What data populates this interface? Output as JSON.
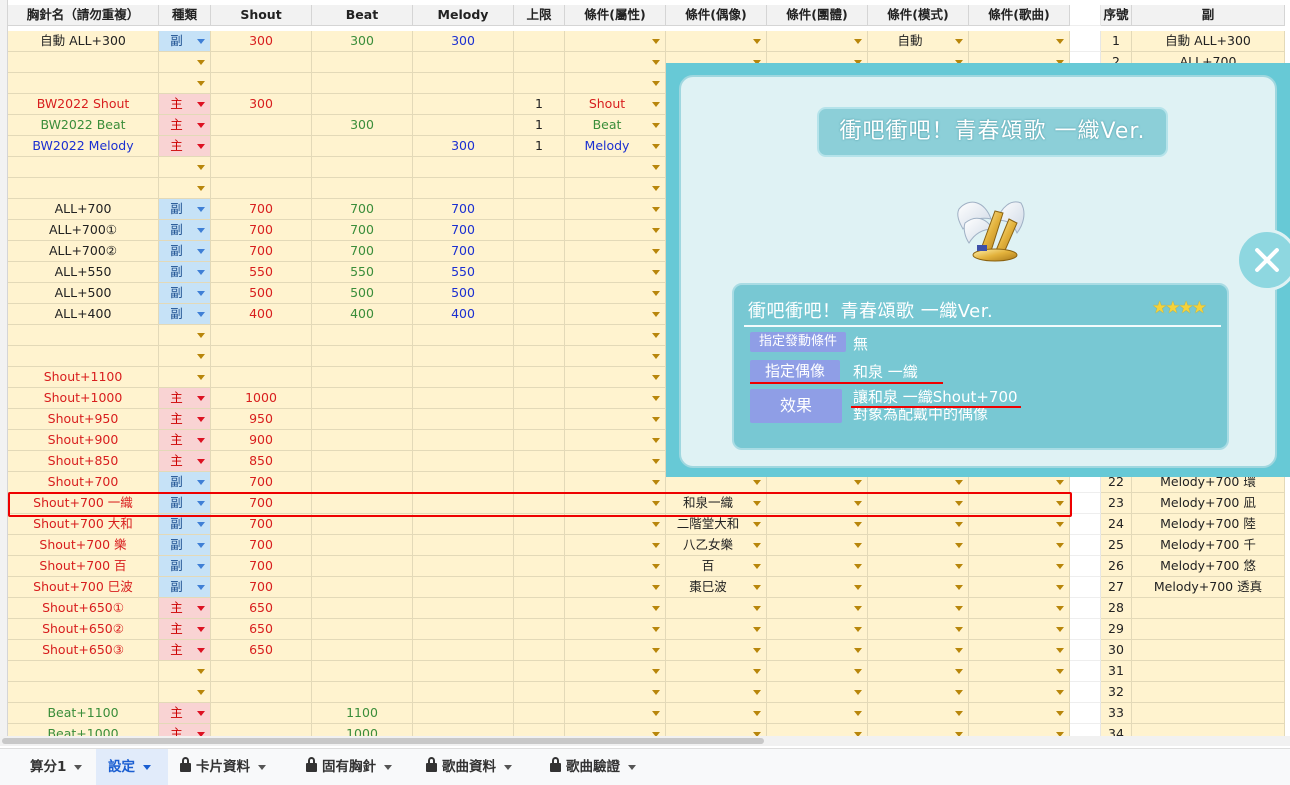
{
  "columns": [
    {
      "key": "name",
      "label": "胸針名（請勿重複）"
    },
    {
      "key": "type",
      "label": "種類"
    },
    {
      "key": "shout",
      "label": "Shout",
      "color": "#d81e1e"
    },
    {
      "key": "beat",
      "label": "Beat",
      "color": "#3a8d3a"
    },
    {
      "key": "melody",
      "label": "Melody",
      "color": "#1b2fd1"
    },
    {
      "key": "limit",
      "label": "上限"
    },
    {
      "key": "attr",
      "label": "條件(屬性)"
    },
    {
      "key": "idol",
      "label": "條件(偶像)"
    },
    {
      "key": "group",
      "label": "條件(團體)"
    },
    {
      "key": "mode",
      "label": "條件(模式)"
    },
    {
      "key": "song",
      "label": "條件(歌曲)"
    },
    {
      "key": "blank",
      "label": ""
    },
    {
      "key": "seq",
      "label": "序號"
    },
    {
      "key": "sub",
      "label": "副"
    }
  ],
  "rows": [
    {
      "name": "自動 ALL+300",
      "nc": "",
      "type": "副",
      "shout": "300",
      "beat": "300",
      "melody": "300",
      "limit": "",
      "attr": "",
      "idol": "",
      "group": "",
      "mode": "自動",
      "song": "",
      "seq": "1",
      "sub": "自動 ALL+300"
    },
    {
      "name": "",
      "nc": "",
      "type": "",
      "shout": "",
      "beat": "",
      "melody": "",
      "limit": "",
      "attr": "",
      "idol": "",
      "group": "",
      "mode": "",
      "song": "",
      "seq": "2",
      "sub": "ALL+700"
    },
    {
      "name": "",
      "nc": "",
      "type": "",
      "shout": "",
      "beat": "",
      "melody": "",
      "limit": "",
      "attr": "",
      "idol": "",
      "group": "",
      "mode": "",
      "song": "",
      "seq": "",
      "sub": ""
    },
    {
      "name": "BW2022 Shout",
      "nc": "red",
      "type": "主",
      "shout": "300",
      "beat": "",
      "melody": "",
      "limit": "1",
      "attr": "Shout",
      "ac": "red",
      "idol": "",
      "group": "",
      "mode": "",
      "song": "",
      "seq": "",
      "sub": ""
    },
    {
      "name": "BW2022 Beat",
      "nc": "green",
      "type": "主",
      "shout": "",
      "beat": "300",
      "melody": "",
      "limit": "1",
      "attr": "Beat",
      "ac": "green",
      "idol": "",
      "group": "",
      "mode": "",
      "song": "",
      "seq": "",
      "sub": ""
    },
    {
      "name": "BW2022 Melody",
      "nc": "blue",
      "type": "主",
      "shout": "",
      "beat": "",
      "melody": "300",
      "limit": "1",
      "attr": "Melody",
      "ac": "blue",
      "idol": "",
      "group": "",
      "mode": "",
      "song": "",
      "seq": "",
      "sub": ""
    },
    {
      "name": "",
      "nc": "",
      "type": "",
      "shout": "",
      "beat": "",
      "melody": "",
      "limit": "",
      "attr": "",
      "idol": "",
      "group": "",
      "mode": "",
      "song": "",
      "seq": "",
      "sub": ""
    },
    {
      "name": "",
      "nc": "",
      "type": "",
      "shout": "",
      "beat": "",
      "melody": "",
      "limit": "",
      "attr": "",
      "idol": "",
      "group": "",
      "mode": "",
      "song": "",
      "seq": "",
      "sub": ""
    },
    {
      "name": "ALL+700",
      "nc": "",
      "type": "副",
      "shout": "700",
      "beat": "700",
      "melody": "700",
      "limit": "",
      "attr": "",
      "idol": "",
      "group": "",
      "mode": "",
      "song": "",
      "seq": "",
      "sub": ""
    },
    {
      "name": "ALL+700①",
      "nc": "",
      "type": "副",
      "shout": "700",
      "beat": "700",
      "melody": "700",
      "limit": "",
      "attr": "",
      "idol": "",
      "group": "",
      "mode": "",
      "song": "",
      "seq": "",
      "sub": ""
    },
    {
      "name": "ALL+700②",
      "nc": "",
      "type": "副",
      "shout": "700",
      "beat": "700",
      "melody": "700",
      "limit": "",
      "attr": "",
      "idol": "",
      "group": "",
      "mode": "",
      "song": "",
      "seq": "",
      "sub": ""
    },
    {
      "name": "ALL+550",
      "nc": "",
      "type": "副",
      "shout": "550",
      "beat": "550",
      "melody": "550",
      "limit": "",
      "attr": "",
      "idol": "",
      "group": "",
      "mode": "",
      "song": "",
      "seq": "",
      "sub": ""
    },
    {
      "name": "ALL+500",
      "nc": "",
      "type": "副",
      "shout": "500",
      "beat": "500",
      "melody": "500",
      "limit": "",
      "attr": "",
      "idol": "",
      "group": "",
      "mode": "",
      "song": "",
      "seq": "",
      "sub": ""
    },
    {
      "name": "ALL+400",
      "nc": "",
      "type": "副",
      "shout": "400",
      "beat": "400",
      "melody": "400",
      "limit": "",
      "attr": "",
      "idol": "",
      "group": "",
      "mode": "",
      "song": "",
      "seq": "",
      "sub": ""
    },
    {
      "name": "",
      "nc": "",
      "type": "",
      "shout": "",
      "beat": "",
      "melody": "",
      "limit": "",
      "attr": "",
      "idol": "",
      "group": "",
      "mode": "",
      "song": "",
      "seq": "",
      "sub": ""
    },
    {
      "name": "",
      "nc": "",
      "type": "",
      "shout": "",
      "beat": "",
      "melody": "",
      "limit": "",
      "attr": "",
      "idol": "",
      "group": "",
      "mode": "",
      "song": "",
      "seq": "",
      "sub": ""
    },
    {
      "name": "Shout+1100",
      "nc": "red",
      "type": "",
      "shout": "",
      "beat": "",
      "melody": "",
      "limit": "",
      "attr": "",
      "idol": "",
      "group": "",
      "mode": "",
      "song": "",
      "seq": "",
      "sub": ""
    },
    {
      "name": "Shout+1000",
      "nc": "red",
      "type": "主",
      "shout": "1000",
      "beat": "",
      "melody": "",
      "limit": "",
      "attr": "",
      "idol": "",
      "group": "",
      "mode": "",
      "song": "",
      "seq": "",
      "sub": ""
    },
    {
      "name": "Shout+950",
      "nc": "red",
      "type": "主",
      "shout": "950",
      "beat": "",
      "melody": "",
      "limit": "",
      "attr": "",
      "idol": "",
      "group": "",
      "mode": "",
      "song": "",
      "seq": "",
      "sub": ""
    },
    {
      "name": "Shout+900",
      "nc": "red",
      "type": "主",
      "shout": "900",
      "beat": "",
      "melody": "",
      "limit": "",
      "attr": "",
      "idol": "",
      "group": "",
      "mode": "",
      "song": "",
      "seq": "",
      "sub": ""
    },
    {
      "name": "Shout+850",
      "nc": "red",
      "type": "主",
      "shout": "850",
      "beat": "",
      "melody": "",
      "limit": "",
      "attr": "",
      "idol": "",
      "group": "",
      "mode": "",
      "song": "",
      "seq": "",
      "sub": ""
    },
    {
      "name": "Shout+700",
      "nc": "red",
      "type": "副",
      "shout": "700",
      "beat": "",
      "melody": "",
      "limit": "",
      "attr": "",
      "idol": "",
      "group": "",
      "mode": "",
      "song": "",
      "seq": "22",
      "sub": "Melody+700 環"
    },
    {
      "name": "Shout+700 一織",
      "nc": "red",
      "type": "副",
      "shout": "700",
      "beat": "",
      "melody": "",
      "limit": "",
      "attr": "",
      "idol": "和泉一織",
      "group": "",
      "mode": "",
      "song": "",
      "seq": "23",
      "sub": "Melody+700 凪"
    },
    {
      "name": "Shout+700 大和",
      "nc": "red",
      "type": "副",
      "shout": "700",
      "beat": "",
      "melody": "",
      "limit": "",
      "attr": "",
      "idol": "二階堂大和",
      "group": "",
      "mode": "",
      "song": "",
      "seq": "24",
      "sub": "Melody+700 陸"
    },
    {
      "name": "Shout+700 樂",
      "nc": "red",
      "type": "副",
      "shout": "700",
      "beat": "",
      "melody": "",
      "limit": "",
      "attr": "",
      "idol": "八乙女樂",
      "group": "",
      "mode": "",
      "song": "",
      "seq": "25",
      "sub": "Melody+700 千"
    },
    {
      "name": "Shout+700 百",
      "nc": "red",
      "type": "副",
      "shout": "700",
      "beat": "",
      "melody": "",
      "limit": "",
      "attr": "",
      "idol": "百",
      "group": "",
      "mode": "",
      "song": "",
      "seq": "26",
      "sub": "Melody+700 悠"
    },
    {
      "name": "Shout+700 巳波",
      "nc": "red",
      "type": "副",
      "shout": "700",
      "beat": "",
      "melody": "",
      "limit": "",
      "attr": "",
      "idol": "棗巳波",
      "group": "",
      "mode": "",
      "song": "",
      "seq": "27",
      "sub": "Melody+700 透真"
    },
    {
      "name": "Shout+650①",
      "nc": "red",
      "type": "主",
      "shout": "650",
      "beat": "",
      "melody": "",
      "limit": "",
      "attr": "",
      "idol": "",
      "group": "",
      "mode": "",
      "song": "",
      "seq": "28",
      "sub": ""
    },
    {
      "name": "Shout+650②",
      "nc": "red",
      "type": "主",
      "shout": "650",
      "beat": "",
      "melody": "",
      "limit": "",
      "attr": "",
      "idol": "",
      "group": "",
      "mode": "",
      "song": "",
      "seq": "29",
      "sub": ""
    },
    {
      "name": "Shout+650③",
      "nc": "red",
      "type": "主",
      "shout": "650",
      "beat": "",
      "melody": "",
      "limit": "",
      "attr": "",
      "idol": "",
      "group": "",
      "mode": "",
      "song": "",
      "seq": "30",
      "sub": ""
    },
    {
      "name": "",
      "nc": "",
      "type": "",
      "shout": "",
      "beat": "",
      "melody": "",
      "limit": "",
      "attr": "",
      "idol": "",
      "group": "",
      "mode": "",
      "song": "",
      "seq": "31",
      "sub": ""
    },
    {
      "name": "",
      "nc": "",
      "type": "",
      "shout": "",
      "beat": "",
      "melody": "",
      "limit": "",
      "attr": "",
      "idol": "",
      "group": "",
      "mode": "",
      "song": "",
      "seq": "32",
      "sub": ""
    },
    {
      "name": "Beat+1100",
      "nc": "green",
      "type": "主",
      "shout": "",
      "beat": "1100",
      "melody": "",
      "limit": "",
      "attr": "",
      "idol": "",
      "group": "",
      "mode": "",
      "song": "",
      "seq": "33",
      "sub": ""
    },
    {
      "name": "Beat+1000",
      "nc": "green",
      "type": "主",
      "shout": "",
      "beat": "1000",
      "melody": "",
      "limit": "",
      "attr": "",
      "idol": "",
      "group": "",
      "mode": "",
      "song": "",
      "seq": "34",
      "sub": ""
    }
  ],
  "highlight_row_index": 22,
  "tabs": [
    {
      "label": "算分1",
      "active": false,
      "locked": false
    },
    {
      "label": "設定",
      "active": true,
      "locked": false
    },
    {
      "label": "卡片資料",
      "active": false,
      "locked": true
    },
    {
      "label": "固有胸針",
      "active": false,
      "locked": true
    },
    {
      "label": "歌曲資料",
      "active": false,
      "locked": true
    },
    {
      "label": "歌曲驗證",
      "active": false,
      "locked": true
    }
  ],
  "popup": {
    "title": "衝吧衝吧！青春頌歌 一織Ver.",
    "card_title": "衝吧衝吧！青春頌歌 一織Ver.",
    "stars": "★★★★",
    "rows": [
      {
        "label": "指定發動條件",
        "value": "無"
      },
      {
        "label": "指定偶像",
        "value": "和泉 一織"
      },
      {
        "label": "效果",
        "value_line1": "讓和泉 一織Shout+700",
        "value_line2": "對象為配戴中的偶像"
      }
    ],
    "icon": "brooch-wings-icon",
    "close_icon": "close-icon"
  },
  "colors": {
    "shout": "#d81e1e",
    "beat": "#3a8d3a",
    "melody": "#1b2fd1",
    "sub_type_bg": "#c6e2f7",
    "main_type_bg": "#f9d3d3",
    "popup_bg": "#67c9d6",
    "highlight": "#e00000"
  }
}
